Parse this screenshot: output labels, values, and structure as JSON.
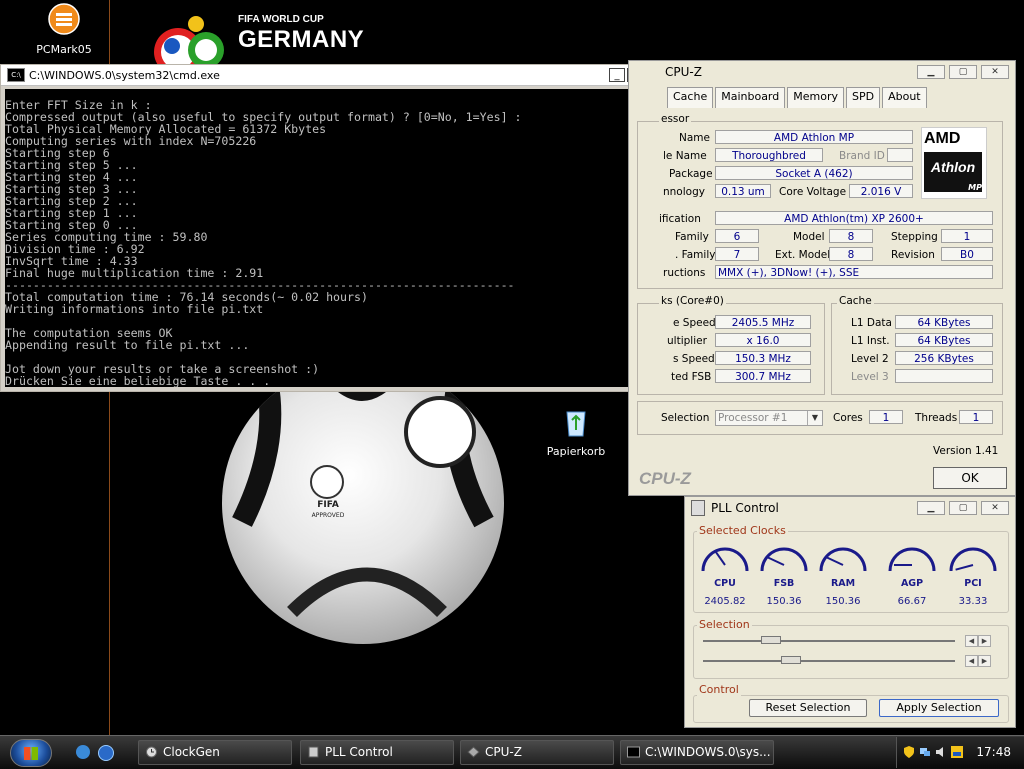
{
  "desktop": {
    "icons": {
      "pcmark": "PCMark05",
      "recycle": "Papierkorb"
    },
    "logo": {
      "line1": "FIFA WORLD CUP",
      "line2": "GERMANY",
      "ball_text": "FIFA",
      "ball_subtext": "APPROVED"
    }
  },
  "cmd": {
    "title": "C:\\WINDOWS.0\\system32\\cmd.exe",
    "lines": [
      "Enter FFT Size in k :",
      "Compressed output (also useful to specify output format) ? [0=No, 1=Yes] :",
      "Total Physical Memory Allocated = 61372 Kbytes",
      "Computing series with index N=705226",
      "Starting step 6",
      "Starting step 5 ...",
      "Starting step 4 ...",
      "Starting step 3 ...",
      "Starting step 2 ...",
      "Starting step 1 ...",
      "Starting step 0 ...",
      "Series computing time : 59.80",
      "Division time : 6.92",
      "InvSqrt time : 4.33",
      "Final huge multiplication time : 2.91",
      "-------------------------------------------------------------------------",
      "Total computation time : 76.14 seconds(~ 0.02 hours)",
      "Writing informations into file pi.txt",
      "",
      "The computation seems OK",
      "Appending result to file pi.txt ...",
      "",
      "Jot down your results or take a screenshot :)",
      "Drücken Sie eine beliebige Taste . . ."
    ],
    "btn_min": "_",
    "btn_max": "□",
    "btn_close": "×"
  },
  "cpuz": {
    "title": "CPU-Z",
    "tabs": [
      "Cache",
      "Mainboard",
      "Memory",
      "SPD",
      "About"
    ],
    "section_processor": "essor",
    "labels": {
      "name": "Name",
      "code_name": "le Name",
      "brand_id": "Brand ID",
      "package": "Package",
      "technology": "nnology",
      "core_voltage": "Core Voltage",
      "specification": "ification",
      "family": "Family",
      "model": "Model",
      "stepping": "Stepping",
      "ext_family": ". Family",
      "ext_model": "Ext. Model",
      "revision": "Revision",
      "instructions": "ructions"
    },
    "values": {
      "name": "AMD Athlon MP",
      "code_name": "Thoroughbred",
      "package": "Socket A (462)",
      "technology": "0.13 um",
      "core_voltage": "2.016 V",
      "specification": "AMD Athlon(tm) XP 2600+",
      "family": "6",
      "model": "8",
      "stepping": "1",
      "ext_family": "7",
      "ext_model": "8",
      "revision": "B0",
      "instructions": "MMX (+), 3DNow! (+), SSE"
    },
    "logo": {
      "brand": "AMD",
      "product": "Athlon",
      "badge": "MP"
    },
    "clocks": {
      "group": "ks (Core#0)",
      "core_speed_label": "e Speed",
      "core_speed": "2405.5 MHz",
      "multiplier_label": "ultiplier",
      "multiplier": "x 16.0",
      "bus_speed_label": "s Speed",
      "bus_speed": "150.3 MHz",
      "rated_fsb_label": "ted FSB",
      "rated_fsb": "300.7 MHz"
    },
    "cache": {
      "group": "Cache",
      "l1_data_label": "L1 Data",
      "l1_data": "64 KBytes",
      "l1_inst_label": "L1 Inst.",
      "l1_inst": "64 KBytes",
      "level2_label": "Level 2",
      "level2": "256 KBytes",
      "level3_label": "Level 3"
    },
    "selection_label": "Selection",
    "selection_value": "Processor #1",
    "cores_label": "Cores",
    "cores": "1",
    "threads_label": "Threads",
    "threads": "1",
    "version": "Version 1.41",
    "brand": "CPU-Z",
    "ok": "OK"
  },
  "pll": {
    "title": "PLL Control",
    "selected_clocks": "Selected Clocks",
    "gauges": [
      {
        "name": "CPU",
        "value": "2405.82"
      },
      {
        "name": "FSB",
        "value": "150.36"
      },
      {
        "name": "RAM",
        "value": "150.36"
      },
      {
        "name": "AGP",
        "value": "66.67"
      },
      {
        "name": "PCI",
        "value": "33.33"
      }
    ],
    "selection": "Selection",
    "control": "Control",
    "reset": "Reset Selection",
    "apply": "Apply Selection"
  },
  "taskbar": {
    "items": [
      "ClockGen",
      "PLL Control",
      "CPU-Z",
      "C:\\WINDOWS.0\\sys..."
    ],
    "clock": "17:48"
  },
  "colors": {
    "accent": "#1a1a8a",
    "group_title": "#a0371a",
    "console_bg": "#000000"
  }
}
